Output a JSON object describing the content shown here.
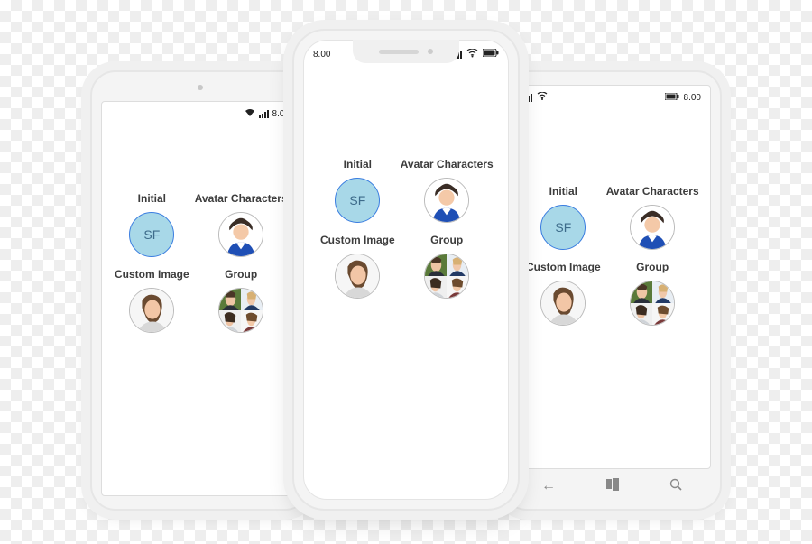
{
  "status": {
    "time": "8.00",
    "android": {
      "wifi": true,
      "signal": true
    },
    "iphone": {
      "wifi": true,
      "signal": true,
      "battery": true
    },
    "win": {
      "wifi": true,
      "signal": true,
      "battery": true
    }
  },
  "cells": {
    "initial": {
      "label": "Initial",
      "text": "SF"
    },
    "character": {
      "label": "Avatar Characters"
    },
    "custom": {
      "label": "Custom Image"
    },
    "group": {
      "label": "Group"
    }
  },
  "winNav": {
    "back": "←",
    "home": "⊞",
    "search": "⌕"
  }
}
